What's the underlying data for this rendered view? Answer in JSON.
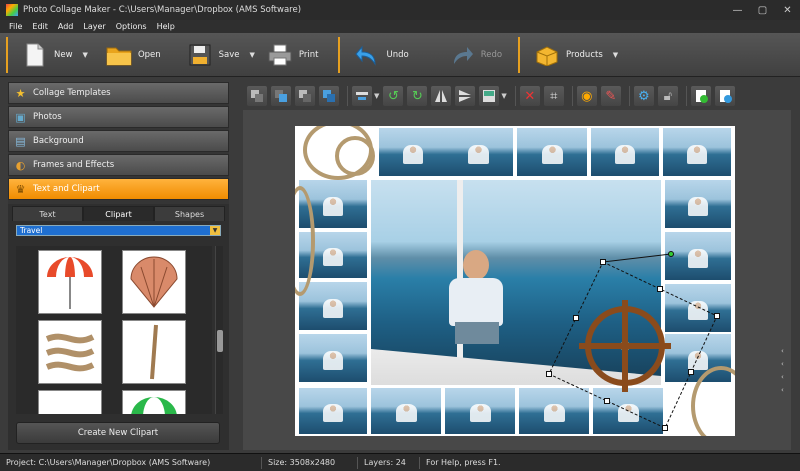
{
  "window": {
    "title": "Photo Collage Maker - C:\\Users\\Manager\\Dropbox (AMS Software)",
    "controls": [
      "—",
      "▢",
      "✕"
    ]
  },
  "menu": [
    "File",
    "Edit",
    "Add",
    "Layer",
    "Options",
    "Help"
  ],
  "toolbar": {
    "new_label": "New",
    "open_label": "Open",
    "save_label": "Save",
    "print_label": "Print",
    "undo_label": "Undo",
    "redo_label": "Redo",
    "products_label": "Products",
    "dropdown_glyph": "▼"
  },
  "sidebar": {
    "sections": [
      {
        "label": "Collage Templates",
        "icon": "star-icon",
        "glyph": "★",
        "active": false
      },
      {
        "label": "Photos",
        "icon": "photo-icon",
        "glyph": "▣",
        "active": false
      },
      {
        "label": "Background",
        "icon": "background-icon",
        "glyph": "▤",
        "active": false
      },
      {
        "label": "Frames and Effects",
        "icon": "palette-icon",
        "glyph": "◐",
        "active": false
      },
      {
        "label": "Text and Clipart",
        "icon": "trophy-icon",
        "glyph": "♛",
        "active": true
      }
    ],
    "tabs": [
      "Text",
      "Clipart",
      "Shapes"
    ],
    "active_tab": "Clipart",
    "category": "Travel",
    "create_button": "Create New Clipart"
  },
  "editor": {
    "side_arrow_glyph": "‹"
  },
  "status": {
    "project": "Project: C:\\Users\\Manager\\Dropbox (AMS Software)",
    "size": "Size: 3508x2480",
    "layers": "Layers: 24",
    "help": "For Help, press F1."
  },
  "colors": {
    "accent": "#f39a10",
    "selection_combo": "#1f6fd0"
  }
}
